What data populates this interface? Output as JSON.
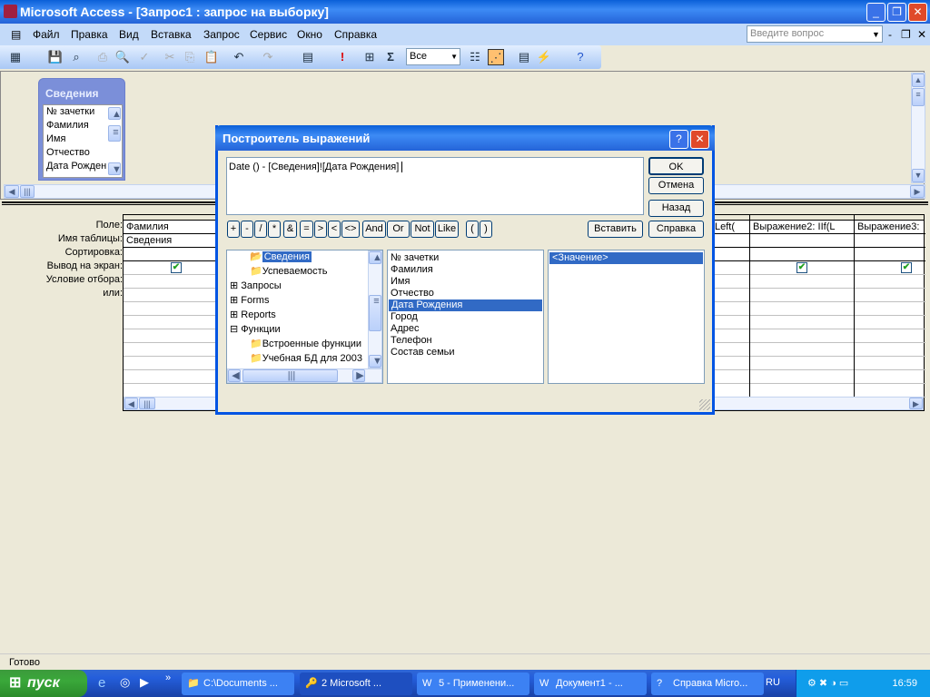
{
  "window": {
    "title": "Microsoft Access - [Запрос1 : запрос на выборку]",
    "help_placeholder": "Введите вопрос"
  },
  "menu": [
    "Файл",
    "Правка",
    "Вид",
    "Вставка",
    "Запрос",
    "Сервис",
    "Окно",
    "Справка"
  ],
  "toolbar": {
    "top_values": "Все"
  },
  "table_box": {
    "title": "Сведения",
    "fields": [
      "№ зачетки",
      "Фамилия",
      "Имя",
      "Отчество",
      "Дата Рожден"
    ]
  },
  "grid": {
    "row_labels": [
      "Поле:",
      "Имя таблицы:",
      "Сортировка:",
      "Вывод на экран:",
      "Условие отбора:",
      "или:"
    ],
    "columns": [
      {
        "field": "Фамилия",
        "table": "Сведения",
        "show": true
      },
      {
        "field": "Left(",
        "table": "",
        "show": true
      },
      {
        "field": "Выражение2: IIf(L",
        "table": "",
        "show": true
      },
      {
        "field": "Выражение3: ",
        "table": "",
        "show": true
      }
    ]
  },
  "dialog": {
    "title": "Построитель выражений",
    "expression": "Date () - [Сведения]![Дата Рождения]",
    "buttons": {
      "ok": "OK",
      "cancel": "Отмена",
      "back": "Назад",
      "help": "Справка",
      "paste": "Вставить"
    },
    "operators": [
      "+",
      "-",
      "/",
      "*",
      "&",
      "=",
      ">",
      "<",
      "<>",
      "And",
      "Or",
      "Not",
      "Like",
      "(",
      ")"
    ],
    "tree": [
      {
        "label": "Сведения",
        "level": 1,
        "selected": true,
        "icon": "folder-open"
      },
      {
        "label": "Успеваемость",
        "level": 1,
        "icon": "folder"
      },
      {
        "label": "Запросы",
        "level": 0,
        "icon": "folder-plus"
      },
      {
        "label": "Forms",
        "level": 0,
        "icon": "folder-plus"
      },
      {
        "label": "Reports",
        "level": 0,
        "icon": "folder-plus"
      },
      {
        "label": "Функции",
        "level": 0,
        "icon": "folder-minus"
      },
      {
        "label": "Встроенные функции",
        "level": 1,
        "icon": "folder"
      },
      {
        "label": "Учебная БД для 2003",
        "level": 1,
        "icon": "folder"
      }
    ],
    "fields": [
      "№ зачетки",
      "Фамилия",
      "Имя",
      "Отчество",
      "Дата Рождения",
      "Город",
      "Адрес",
      "Телефон",
      "Состав семьи"
    ],
    "selected_field": "Дата Рождения",
    "values": [
      "<Значение>"
    ]
  },
  "status": "Готово",
  "taskbar": {
    "start": "пуск",
    "tasks": [
      "C:\\Documents ...",
      "2 Microsoft ...",
      "5 - Применени...",
      "Документ1 - ...",
      "Справка Micro..."
    ],
    "lang": "RU",
    "clock": "16:59"
  }
}
